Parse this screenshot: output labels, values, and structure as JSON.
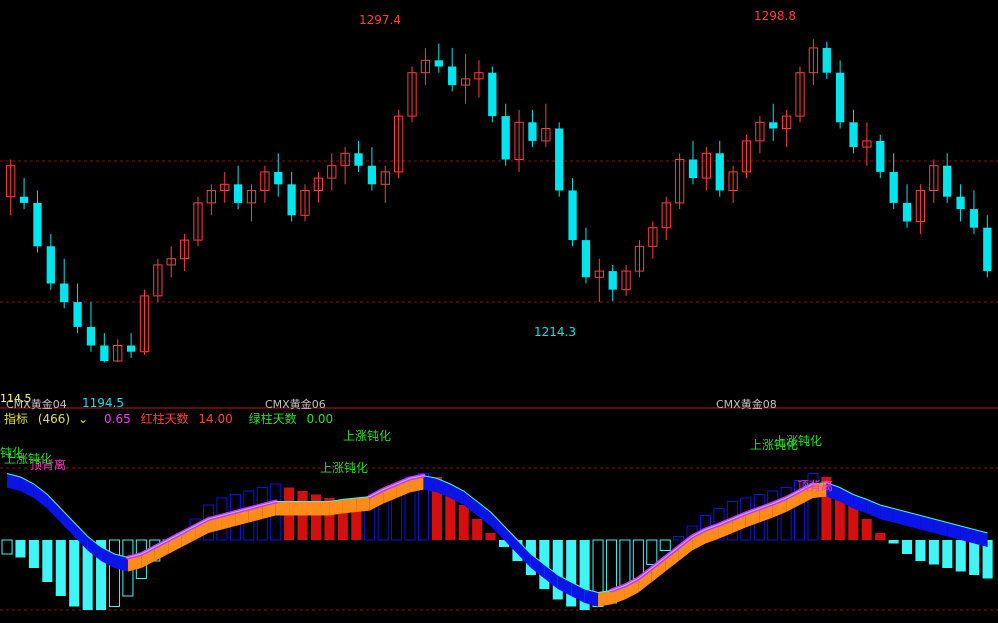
{
  "colors": {
    "background": "#000000",
    "up": "#ff3c3c",
    "down": "#00e5ee",
    "grid": "#8a1010",
    "separator": "#c01818",
    "blue": "#0a14e6",
    "cyan": "#3ff5f5",
    "red": "#d40f0f",
    "orange": "#ff8c1a",
    "magenta": "#ff1aff",
    "green_text": "#22e022",
    "magenta_text": "#ff33cc"
  },
  "price_panel": {
    "high_label": "1297.4",
    "high_label_2": "1298.8",
    "low_label": "1194.5",
    "low_label_2": "1214.3",
    "left_edge_label": "114.5",
    "contract_labels": [
      "CMX黄金04",
      "CMX黄金06",
      "CMX黄金08"
    ]
  },
  "indicator_panel": {
    "name": "指标",
    "period": "(466)",
    "dropdown_icon": "chevron-down-icon",
    "value": "0.65",
    "red_days_label": "红柱天数",
    "red_days_value": "14.00",
    "green_days_label": "绿柱天数",
    "green_days_value": "0.00",
    "annotations": {
      "up_dulling": "上涨钝化",
      "top_divergence": "顶背离",
      "bottom_dulling_partial": "钝化"
    }
  },
  "chart_data": {
    "type": "candlestick",
    "ylim": [
      1185,
      1305
    ],
    "candles": [
      [
        1248,
        1260,
        1242,
        1258
      ],
      [
        1248,
        1254,
        1244,
        1246
      ],
      [
        1246,
        1250,
        1230,
        1232
      ],
      [
        1232,
        1236,
        1218,
        1220
      ],
      [
        1220,
        1228,
        1212,
        1214
      ],
      [
        1214,
        1220,
        1204,
        1206
      ],
      [
        1206,
        1214,
        1198,
        1200
      ],
      [
        1200,
        1204,
        1194.5,
        1195
      ],
      [
        1195,
        1202,
        1194.6,
        1200
      ],
      [
        1200,
        1204,
        1196,
        1198
      ],
      [
        1198,
        1218,
        1197,
        1216
      ],
      [
        1216,
        1228,
        1214,
        1226
      ],
      [
        1226,
        1232,
        1222,
        1228
      ],
      [
        1228,
        1236,
        1224,
        1234
      ],
      [
        1234,
        1248,
        1232,
        1246
      ],
      [
        1246,
        1252,
        1242,
        1250
      ],
      [
        1250,
        1256,
        1246,
        1252
      ],
      [
        1252,
        1258,
        1244,
        1246
      ],
      [
        1246,
        1252,
        1240,
        1250
      ],
      [
        1250,
        1258,
        1246,
        1256
      ],
      [
        1256,
        1262,
        1248,
        1252
      ],
      [
        1252,
        1256,
        1240,
        1242
      ],
      [
        1242,
        1252,
        1240,
        1250
      ],
      [
        1250,
        1256,
        1246,
        1254
      ],
      [
        1254,
        1262,
        1250,
        1258
      ],
      [
        1258,
        1264,
        1252,
        1262
      ],
      [
        1262,
        1266,
        1256,
        1258
      ],
      [
        1258,
        1264,
        1250,
        1252
      ],
      [
        1252,
        1258,
        1246,
        1256
      ],
      [
        1256,
        1276,
        1254,
        1274
      ],
      [
        1274,
        1290,
        1272,
        1288
      ],
      [
        1288,
        1296,
        1284,
        1292
      ],
      [
        1292,
        1297.4,
        1288,
        1290
      ],
      [
        1290,
        1296,
        1282,
        1284
      ],
      [
        1284,
        1294,
        1278,
        1286
      ],
      [
        1286,
        1292,
        1280,
        1288
      ],
      [
        1288,
        1290,
        1272,
        1274
      ],
      [
        1274,
        1278,
        1258,
        1260
      ],
      [
        1260,
        1276,
        1256,
        1272
      ],
      [
        1272,
        1276,
        1264,
        1266
      ],
      [
        1266,
        1278,
        1264,
        1270
      ],
      [
        1270,
        1272,
        1248,
        1250
      ],
      [
        1250,
        1254,
        1232,
        1234
      ],
      [
        1234,
        1238,
        1220,
        1222
      ],
      [
        1222,
        1228,
        1214,
        1224
      ],
      [
        1224,
        1226,
        1214.3,
        1218
      ],
      [
        1218,
        1226,
        1216,
        1224
      ],
      [
        1224,
        1234,
        1222,
        1232
      ],
      [
        1232,
        1240,
        1228,
        1238
      ],
      [
        1238,
        1248,
        1234,
        1246
      ],
      [
        1246,
        1262,
        1244,
        1260
      ],
      [
        1260,
        1266,
        1252,
        1254
      ],
      [
        1254,
        1264,
        1250,
        1262
      ],
      [
        1262,
        1266,
        1248,
        1250
      ],
      [
        1250,
        1258,
        1246,
        1256
      ],
      [
        1256,
        1268,
        1254,
        1266
      ],
      [
        1266,
        1274,
        1262,
        1272
      ],
      [
        1272,
        1278,
        1266,
        1270
      ],
      [
        1270,
        1276,
        1264,
        1274
      ],
      [
        1274,
        1290,
        1272,
        1288
      ],
      [
        1288,
        1298.8,
        1284,
        1296
      ],
      [
        1296,
        1298,
        1286,
        1288
      ],
      [
        1288,
        1292,
        1270,
        1272
      ],
      [
        1272,
        1276,
        1262,
        1264
      ],
      [
        1264,
        1272,
        1258,
        1266
      ],
      [
        1266,
        1268,
        1254,
        1256
      ],
      [
        1256,
        1262,
        1244,
        1246
      ],
      [
        1246,
        1252,
        1238,
        1240
      ],
      [
        1240,
        1252,
        1236,
        1250
      ],
      [
        1250,
        1260,
        1246,
        1258
      ],
      [
        1258,
        1262,
        1246,
        1248
      ],
      [
        1248,
        1252,
        1240,
        1244
      ],
      [
        1244,
        1250,
        1236,
        1238
      ],
      [
        1238,
        1242,
        1222,
        1224
      ]
    ],
    "histogram": [
      -0.2,
      -0.25,
      -0.4,
      -0.6,
      -0.8,
      -0.95,
      -1.0,
      -1.0,
      -0.95,
      -0.8,
      -0.55,
      -0.3,
      -0.1,
      0.1,
      0.3,
      0.5,
      0.6,
      0.65,
      0.7,
      0.75,
      0.8,
      0.75,
      0.7,
      0.65,
      0.6,
      0.55,
      0.5,
      0.5,
      0.6,
      0.8,
      0.9,
      0.95,
      0.9,
      0.7,
      0.5,
      0.3,
      0.1,
      -0.1,
      -0.3,
      -0.5,
      -0.7,
      -0.85,
      -0.95,
      -1.0,
      -0.95,
      -0.9,
      -0.75,
      -0.55,
      -0.35,
      -0.15,
      0.05,
      0.2,
      0.35,
      0.45,
      0.55,
      0.6,
      0.65,
      0.7,
      0.75,
      0.85,
      0.95,
      0.9,
      0.7,
      0.5,
      0.3,
      0.1,
      -0.05,
      -0.2,
      -0.3,
      -0.35,
      -0.4,
      -0.45,
      -0.5,
      -0.55
    ],
    "signal_line": [
      0.95,
      0.9,
      0.8,
      0.65,
      0.45,
      0.25,
      0.05,
      -0.1,
      -0.2,
      -0.25,
      -0.2,
      -0.1,
      0.0,
      0.1,
      0.2,
      0.3,
      0.35,
      0.4,
      0.45,
      0.5,
      0.55,
      0.55,
      0.55,
      0.55,
      0.55,
      0.58,
      0.6,
      0.62,
      0.72,
      0.8,
      0.88,
      0.92,
      0.88,
      0.8,
      0.7,
      0.55,
      0.4,
      0.2,
      0.0,
      -0.2,
      -0.35,
      -0.5,
      -0.6,
      -0.7,
      -0.75,
      -0.72,
      -0.65,
      -0.55,
      -0.4,
      -0.25,
      -0.1,
      0.05,
      0.15,
      0.22,
      0.3,
      0.38,
      0.45,
      0.52,
      0.6,
      0.7,
      0.8,
      0.82,
      0.75,
      0.65,
      0.58,
      0.5,
      0.45,
      0.4,
      0.35,
      0.3,
      0.25,
      0.2,
      0.15,
      0.1
    ]
  }
}
